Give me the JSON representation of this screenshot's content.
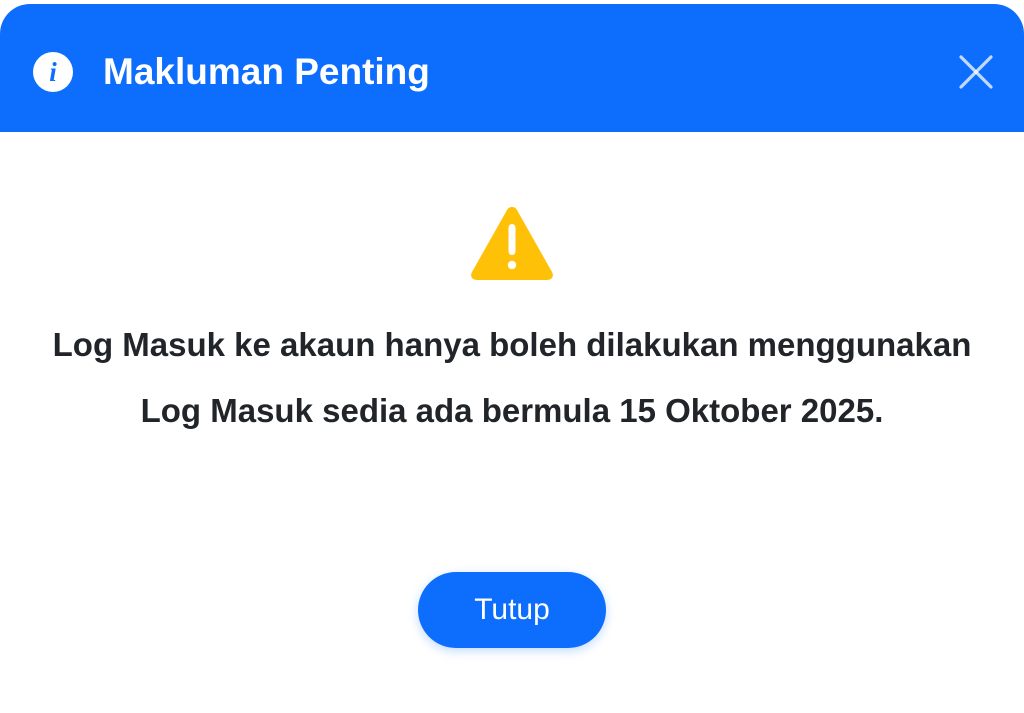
{
  "dialog": {
    "title": "Makluman Penting",
    "message": "Log Masuk ke akaun hanya boleh dilakukan menggunakan Log Masuk sedia ada bermula 15 Oktober 2025.",
    "close_button_label": "Tutup",
    "info_icon_glyph": "i"
  },
  "icons": {
    "header_icon": "info-icon",
    "close_icon": "close-icon",
    "body_icon": "warning-icon"
  },
  "colors": {
    "header_background": "#0d6efd",
    "button_background": "#0d6efd",
    "warning": "#ffc107",
    "text": "#212529"
  }
}
